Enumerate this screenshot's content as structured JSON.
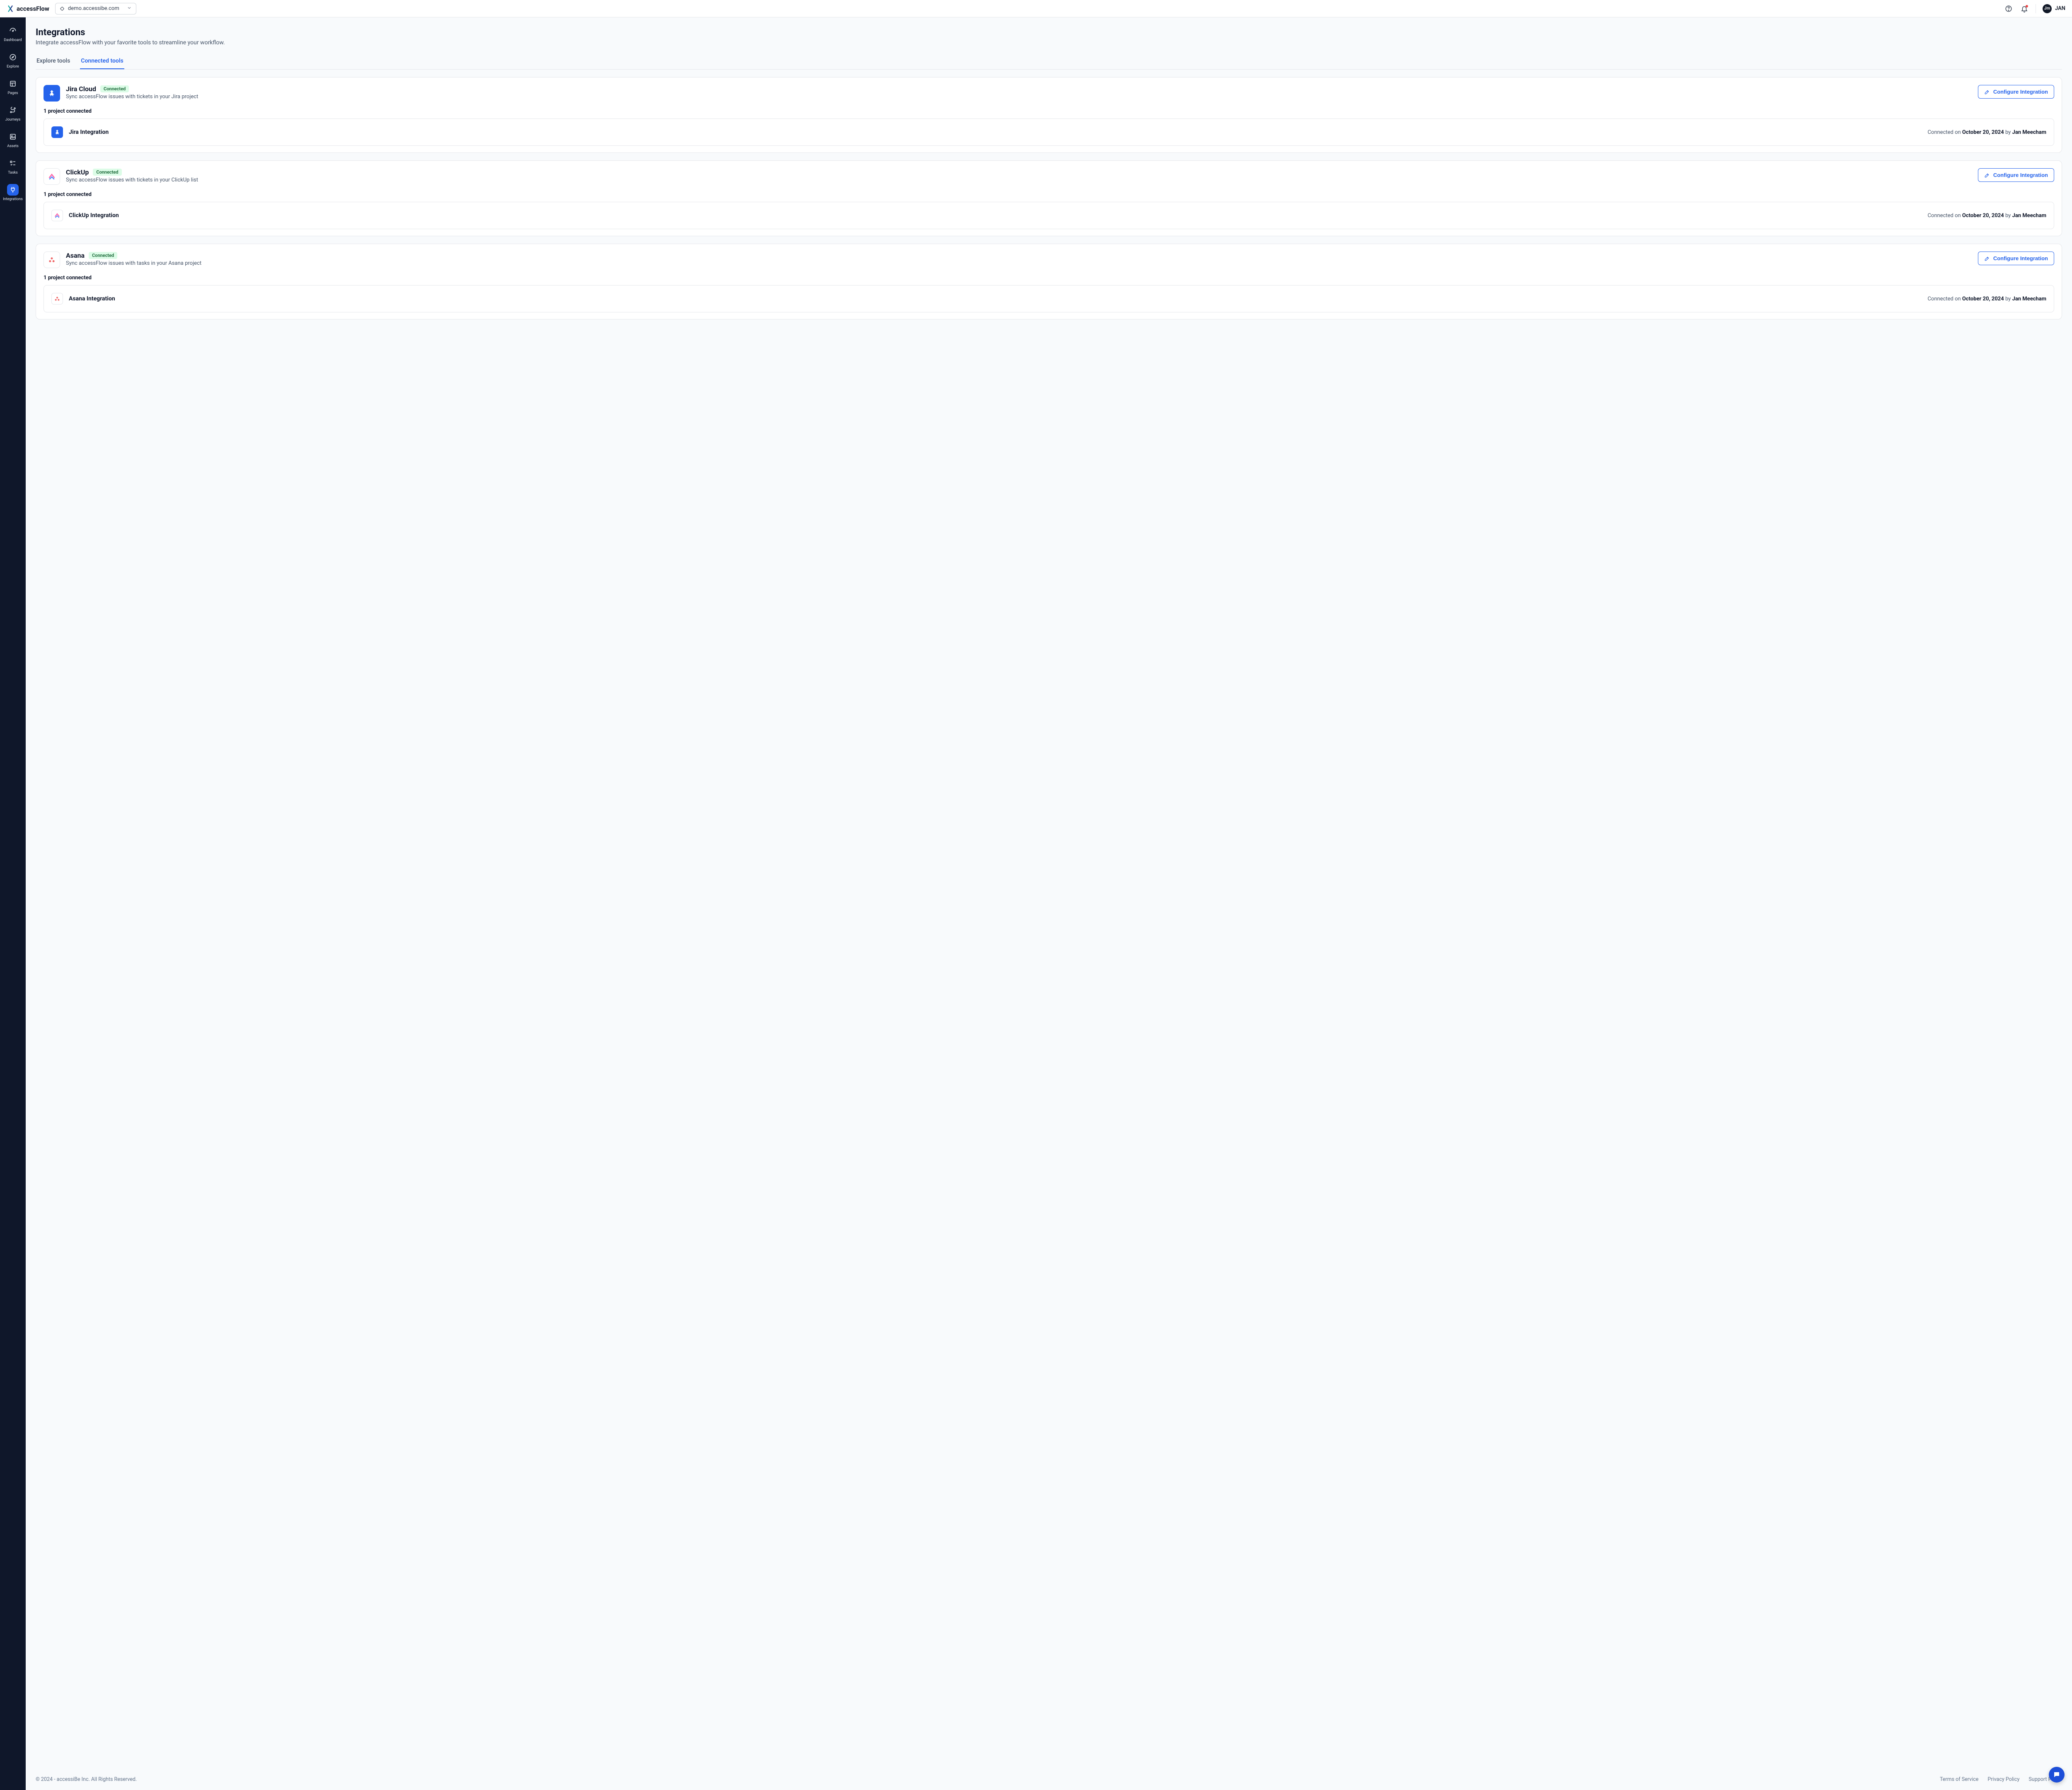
{
  "brand": "accessFlow",
  "domain": "demo.accessibe.com",
  "user": {
    "initials": "Jm",
    "short": "JAN"
  },
  "sidebar": {
    "items": [
      {
        "label": "Dashboard"
      },
      {
        "label": "Explore"
      },
      {
        "label": "Pages"
      },
      {
        "label": "Journeys"
      },
      {
        "label": "Assets"
      },
      {
        "label": "Tasks"
      },
      {
        "label": "Integrations"
      }
    ]
  },
  "page": {
    "title": "Integrations",
    "subtitle": "Integrate accessFlow with your favorite tools to streamline your workflow."
  },
  "tabs": {
    "explore": "Explore tools",
    "connected": "Connected tools"
  },
  "badge_connected": "Connected",
  "config_label": "Configure Integration",
  "integrations": [
    {
      "name": "Jira Cloud",
      "desc": "Sync accessFlow issues with tickets in your Jira project",
      "count_label": "1 project connected",
      "project": {
        "name": "Jira Integration",
        "prefix": "Connected on ",
        "date": "October 20, 2024",
        "by_word": " by ",
        "by": "Jan Meecham"
      }
    },
    {
      "name": "ClickUp",
      "desc": "Sync accessFlow issues with tickets in your ClickUp list",
      "count_label": "1 project connected",
      "project": {
        "name": "ClickUp Integration",
        "prefix": "Connected on ",
        "date": "October 20, 2024",
        "by_word": " by ",
        "by": "Jan Meecham"
      }
    },
    {
      "name": "Asana",
      "desc": "Sync accessFlow issues with tasks in your Asana project",
      "count_label": "1 project connected",
      "project": {
        "name": "Asana Integration",
        "prefix": "Connected on ",
        "date": "October 20, 2024",
        "by_word": " by ",
        "by": "Jan Meecham"
      }
    }
  ],
  "footer": {
    "copyright": "© 2024 - accessiBe Inc. All Rights Reserved.",
    "links": {
      "tos": "Terms of Service",
      "privacy": "Privacy Policy",
      "support": "Support Portal"
    }
  }
}
